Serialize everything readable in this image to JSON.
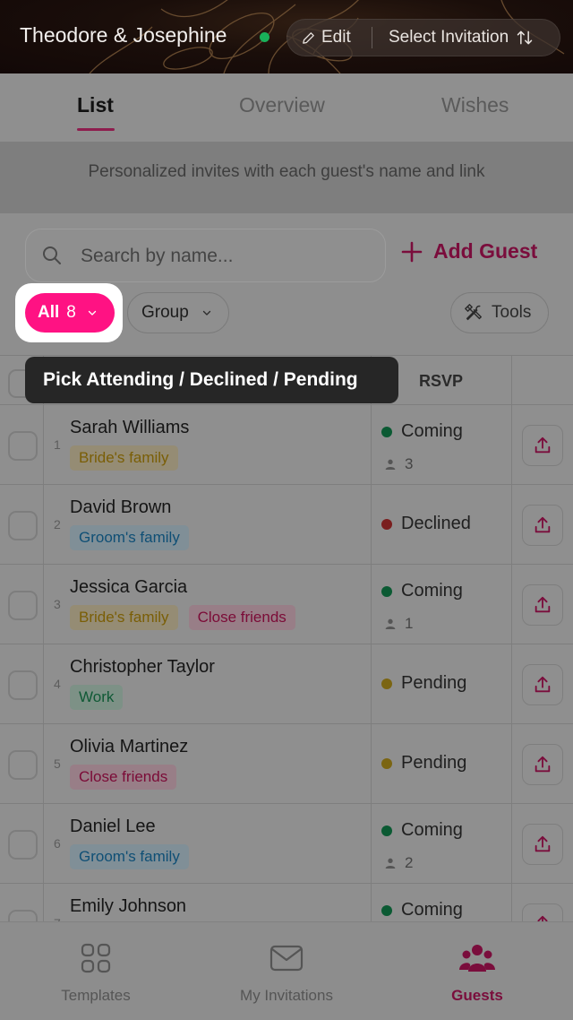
{
  "header": {
    "couple_name": "Theodore & Josephine",
    "edit_label": "Edit",
    "select_label": "Select Invitation"
  },
  "tabs": [
    {
      "label": "List",
      "active": true
    },
    {
      "label": "Overview",
      "active": false
    },
    {
      "label": "Wishes",
      "active": false
    }
  ],
  "banner_text": "Personalized invites with each guest's name and link",
  "search": {
    "placeholder": "Search by name..."
  },
  "add_guest_label": "Add Guest",
  "filters": {
    "all_label": "All",
    "all_count": "8",
    "group_label": "Group",
    "tools_label": "Tools"
  },
  "tooltip": "Pick Attending / Declined / Pending",
  "table": {
    "rsvp_header": "RSVP",
    "rows": [
      {
        "num": "1",
        "name": "Sarah Williams",
        "tags": [
          {
            "label": "Bride's family",
            "type": "bride"
          }
        ],
        "status": "Coming",
        "status_color": "green",
        "guests": "3"
      },
      {
        "num": "2",
        "name": "David Brown",
        "tags": [
          {
            "label": "Groom's family",
            "type": "groom"
          }
        ],
        "status": "Declined",
        "status_color": "red",
        "guests": ""
      },
      {
        "num": "3",
        "name": "Jessica Garcia",
        "tags": [
          {
            "label": "Bride's family",
            "type": "bride"
          },
          {
            "label": "Close friends",
            "type": "friends"
          }
        ],
        "status": "Coming",
        "status_color": "green",
        "guests": "1"
      },
      {
        "num": "4",
        "name": "Christopher Taylor",
        "tags": [
          {
            "label": "Work",
            "type": "work"
          }
        ],
        "status": "Pending",
        "status_color": "yellow",
        "guests": ""
      },
      {
        "num": "5",
        "name": "Olivia Martinez",
        "tags": [
          {
            "label": "Close friends",
            "type": "friends"
          }
        ],
        "status": "Pending",
        "status_color": "yellow",
        "guests": ""
      },
      {
        "num": "6",
        "name": "Daniel Lee",
        "tags": [
          {
            "label": "Groom's family",
            "type": "groom"
          }
        ],
        "status": "Coming",
        "status_color": "green",
        "guests": "2"
      },
      {
        "num": "7",
        "name": "Emily Johnson",
        "tags": [],
        "status": "Coming",
        "status_color": "green",
        "guests": ""
      }
    ]
  },
  "bottom_nav": [
    {
      "label": "Templates",
      "icon": "templates-grid-icon",
      "active": false
    },
    {
      "label": "My Invitations",
      "icon": "envelope-icon",
      "active": false
    },
    {
      "label": "Guests",
      "icon": "guests-group-icon",
      "active": true
    }
  ],
  "colors": {
    "accent": "#ff1283",
    "accent_text": "#7a0d3c",
    "online": "#19b15a"
  }
}
